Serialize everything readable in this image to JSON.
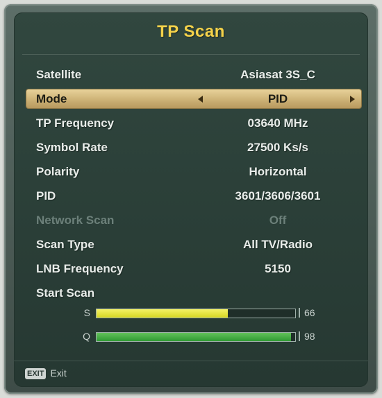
{
  "title": "TP Scan",
  "rows": [
    {
      "label": "Satellite",
      "value": "Asiasat 3S_C"
    },
    {
      "label": "Mode",
      "value": "PID"
    },
    {
      "label": "TP Frequency",
      "value": "03640 MHz"
    },
    {
      "label": "Symbol Rate",
      "value": "27500 Ks/s"
    },
    {
      "label": "Polarity",
      "value": "Horizontal"
    },
    {
      "label": "PID",
      "value": "3601/3606/3601"
    },
    {
      "label": "Network Scan",
      "value": "Off"
    },
    {
      "label": "Scan Type",
      "value": "All TV/Radio"
    },
    {
      "label": "LNB Frequency",
      "value": "5150"
    },
    {
      "label": "Start Scan",
      "value": ""
    }
  ],
  "meters": {
    "strength": {
      "label": "S",
      "value": "66",
      "level": 0.66
    },
    "quality": {
      "label": "Q",
      "value": "98",
      "level": 0.98
    }
  },
  "footer": {
    "key": "EXIT",
    "label": "Exit"
  },
  "colors": {
    "title": "#f4d24a",
    "highlight": "#cdb276",
    "strength_bar": "#d6d622",
    "quality_bar": "#2f9a33"
  }
}
